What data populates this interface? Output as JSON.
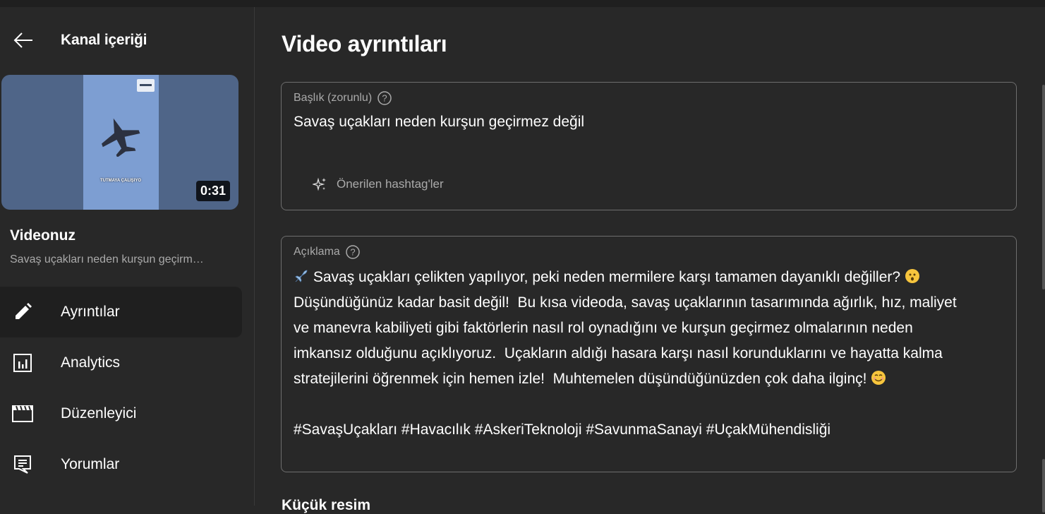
{
  "sidebar": {
    "back_title": "Kanal içeriği",
    "thumbnail": {
      "duration": "0:31",
      "caption": "TUTMAYA ÇALIŞIYO"
    },
    "video_label": "Videonuz",
    "video_title_truncated": "Savaş uçakları neden kurşun geçirm…",
    "nav": [
      {
        "label": "Ayrıntılar",
        "icon": "pencil-icon",
        "active": true
      },
      {
        "label": "Analytics",
        "icon": "analytics-icon",
        "active": false
      },
      {
        "label": "Düzenleyici",
        "icon": "clapper-icon",
        "active": false
      },
      {
        "label": "Yorumlar",
        "icon": "comments-icon",
        "active": false
      }
    ]
  },
  "main": {
    "page_title": "Video ayrıntıları",
    "title_field": {
      "label": "Başlık (zorunlu)",
      "value": "Savaş uçakları neden kurşun geçirmez değil",
      "hashtag_suggestion": "Önerilen hashtag'ler"
    },
    "description_field": {
      "label": "Açıklama",
      "lines": [
        "Savaş uçakları çelikten yapılıyor, peki neden mermilere karşı tamamen dayanıklı değiller?",
        "Düşündüğünüz kadar basit değil!  Bu kısa videoda, savaş uçaklarının tasarımında ağırlık, hız, maliyet",
        "ve manevra kabiliyeti gibi faktörlerin nasıl rol oynadığını ve kurşun geçirmez olmalarının neden",
        "imkansız olduğunu açıklıyoruz.  Uçakların aldığı hasara karşı nasıl korunduklarını ve hayatta kalma",
        "stratejilerini öğrenmek için hemen izle!  Muhtemelen düşündüğünüzden çok daha ilginç!",
        "",
        "#SavaşUçakları #Havacılık #AskeriTeknoloji #SavunmaSanayi #UçakMühendisliği"
      ]
    },
    "next_heading": "Küçük resim"
  }
}
